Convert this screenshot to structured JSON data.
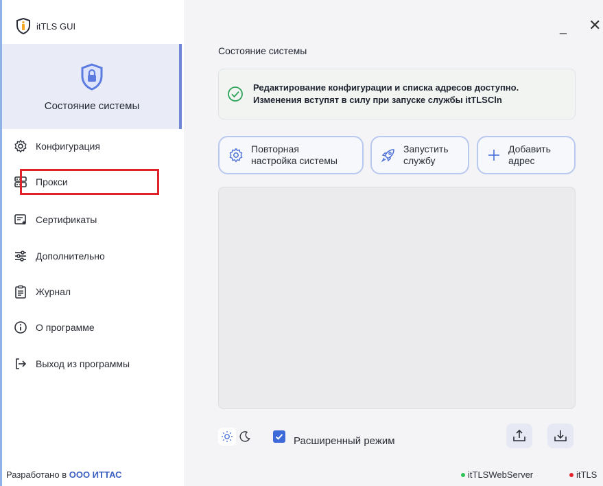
{
  "app": {
    "title": "itTLS GUI"
  },
  "sidebar": {
    "active": {
      "label": "Состояние системы",
      "icon": "shield-lock-icon"
    },
    "items": [
      {
        "label": "Конфигурация",
        "icon": "gear-icon"
      },
      {
        "label": "Прокси",
        "icon": "server-icon"
      },
      {
        "label": "Сертификаты",
        "icon": "certificate-icon"
      },
      {
        "label": "Дополнительно",
        "icon": "sliders-icon"
      },
      {
        "label": "Журнал",
        "icon": "clipboard-icon"
      },
      {
        "label": "О программе",
        "icon": "info-icon"
      },
      {
        "label": "Выход из программы",
        "icon": "exit-icon"
      }
    ],
    "footer": {
      "prefix": "Разработано в",
      "company": "ООО ИТТАС"
    }
  },
  "window": {
    "minimize": "_",
    "close": "✕"
  },
  "main": {
    "title": "Состояние системы",
    "info": {
      "line1": "Редактирование конфигурации и списка адресов доступно.",
      "line2": "Изменения вступят в силу при запуске службы itTLSCln"
    },
    "buttons": [
      {
        "label": "Повторная\nнастройка системы",
        "icon": "reconfigure-icon"
      },
      {
        "label": "Запустить\nслужбу",
        "icon": "rocket-icon"
      },
      {
        "label": "Добавить\nадрес",
        "icon": "plus-icon"
      }
    ],
    "advanced_mode": {
      "label": "Расширенный режим",
      "checked": true
    },
    "status": [
      {
        "name": "itTLSWebServer",
        "color": "#2ec45a"
      },
      {
        "name": "itTLS",
        "color": "#e2222a"
      }
    ]
  },
  "colors": {
    "accent": "#3d6ad8",
    "highlight": "#e2222a",
    "active_bg": "#e9ecf6"
  }
}
